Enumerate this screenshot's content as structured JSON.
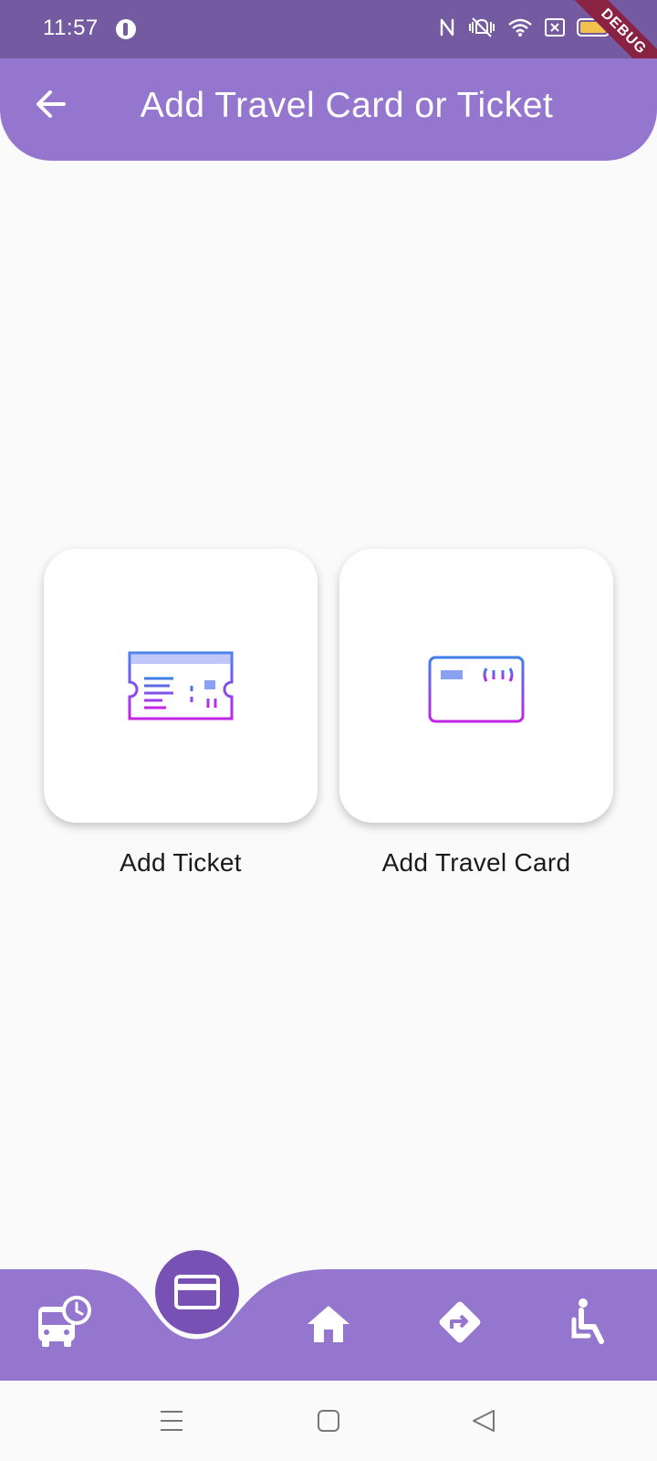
{
  "status_bar": {
    "time": "11:57",
    "battery": "94",
    "debug_label": "DEBUG",
    "icons": [
      "app-icon",
      "nfc-icon",
      "vibrate-icon",
      "wifi-icon",
      "sim-off-icon",
      "battery-icon"
    ]
  },
  "app_bar": {
    "title": "Add Travel Card or Ticket",
    "back_icon": "arrow-back-icon",
    "color": "#9576cf"
  },
  "options": [
    {
      "label": "Add Ticket",
      "icon": "ticket-icon"
    },
    {
      "label": "Add Travel Card",
      "icon": "travel-card-icon"
    }
  ],
  "bottom_nav": {
    "items": [
      "bus-schedule-icon",
      "card-icon",
      "home-icon",
      "directions-icon",
      "accessibility-icon"
    ],
    "active": "card-icon",
    "color": "#9576cf",
    "active_color": "#7752b4"
  },
  "system_nav": [
    "menu-icon",
    "home-square-icon",
    "back-triangle-icon"
  ]
}
